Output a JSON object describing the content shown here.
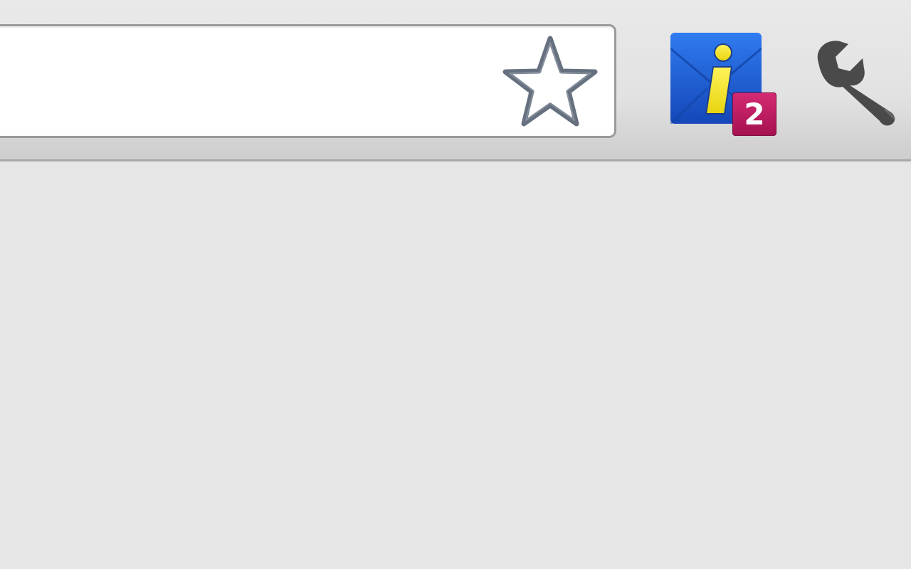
{
  "omnibox": {
    "value": ""
  },
  "toolbar": {
    "bookmark_star_icon": "star-outline-icon",
    "extension_icon": "info-mail-icon",
    "extension_badge_count": "2",
    "menu_icon": "wrench-icon"
  },
  "colors": {
    "toolbar_bg": "#e2e2e2",
    "page_bg": "#e6e6e6",
    "omnibox_border": "#9a9a9a",
    "star_stroke": "#66707f",
    "extension_blue": "#1e5fd6",
    "extension_i_yellow": "#f4e81e",
    "badge_pink": "#b8175c",
    "wrench_gray": "#4a4a4a"
  }
}
